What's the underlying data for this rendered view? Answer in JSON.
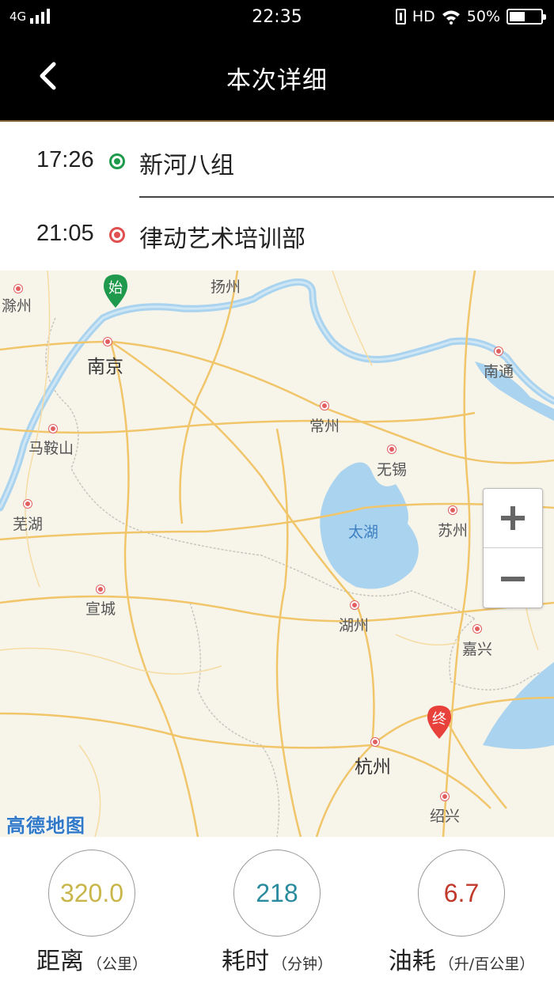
{
  "status_bar": {
    "network": "4G",
    "time": "22:35",
    "hd": "HD",
    "battery": "50%"
  },
  "header": {
    "title": "本次详细"
  },
  "route": {
    "start": {
      "time": "17:26",
      "place": "新河八组"
    },
    "end": {
      "time": "21:05",
      "place": "律动艺术培训部"
    }
  },
  "map": {
    "cities": {
      "chuzhou": "滁州",
      "yangzhou": "扬州",
      "nanjing": "南京",
      "nantong": "南通",
      "changzhou": "常州",
      "maanshan": "马鞍山",
      "wuxi": "无锡",
      "wuhu": "芜湖",
      "suzhou": "苏州",
      "xuancheng": "宣城",
      "huzhou": "湖州",
      "jiaxing": "嘉兴",
      "hangzhou": "杭州",
      "shaoxing": "绍兴"
    },
    "lake": "太湖",
    "start_marker": "始",
    "end_marker": "终",
    "logo": "高德地图",
    "start_color": "#1f9a4c",
    "end_color": "#e8403a",
    "water_color": "#a9d3ee",
    "road_color": "#f1c56a"
  },
  "stats": {
    "distance": {
      "value": "320.0",
      "label": "距离",
      "unit": "（公里）",
      "color": "#c9b64a"
    },
    "duration": {
      "value": "218",
      "label": "耗时",
      "unit": "（分钟）",
      "color": "#2a8a9e"
    },
    "fuel": {
      "value": "6.7",
      "label": "油耗",
      "unit": "（升/百公里）",
      "color": "#c0392b"
    }
  }
}
